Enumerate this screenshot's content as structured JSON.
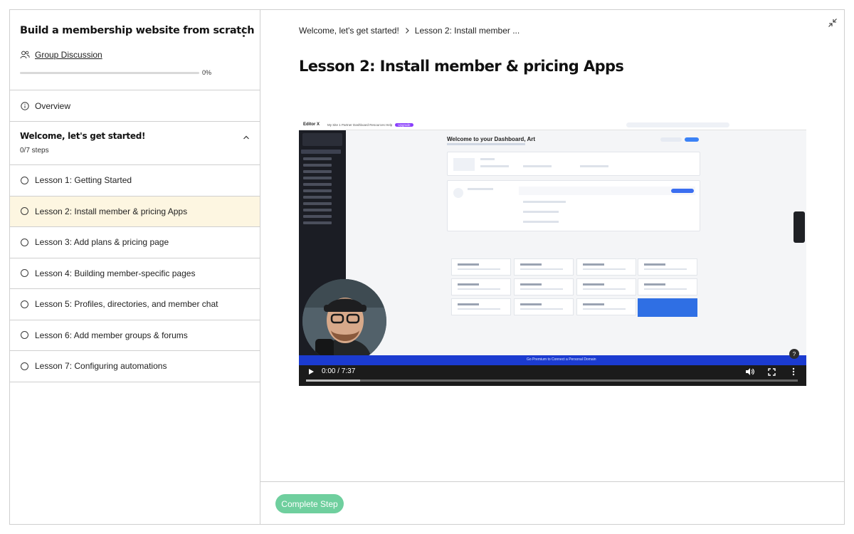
{
  "course": {
    "title": "Build a membership website from scratch",
    "group_discussion": "Group Discussion",
    "progress_label": "0%",
    "progress_fraction": 0
  },
  "overview_label": "Overview",
  "section": {
    "title": "Welcome, let's get started!",
    "steps": "0/7 steps"
  },
  "lessons": [
    {
      "label": "Lesson 1: Getting Started",
      "active": false
    },
    {
      "label": "Lesson 2: Install member & pricing Apps",
      "active": true
    },
    {
      "label": "Lesson 3: Add plans & pricing page",
      "active": false
    },
    {
      "label": "Lesson 4: Building member-specific pages",
      "active": false
    },
    {
      "label": "Lesson 5: Profiles, directories, and member chat",
      "active": false
    },
    {
      "label": "Lesson 6: Add member groups & forums",
      "active": false
    },
    {
      "label": "Lesson 7: Configuring automations",
      "active": false
    }
  ],
  "breadcrumb": {
    "first": "Welcome, let's get started!",
    "second": "Lesson 2: Install member ..."
  },
  "lesson_title": "Lesson 2: Install member & pricing Apps",
  "video": {
    "time": "0:00 / 7:37",
    "screen_title": "Welcome to your Dashboard, Art",
    "editor_brand": "Editor X",
    "editor_menu": "My Site 1   Partner Dashboard   Resources   Help",
    "editor_upgrade": "Upgrade",
    "premium_banner": "Go Premium to Connect a Personal Domain",
    "help_label": "?"
  },
  "complete_button": "Complete Step",
  "colors": {
    "active_lesson_bg": "#fdf6e1",
    "complete_button": "#6fcf9e",
    "video_blue_bar": "#1b3bd0"
  }
}
